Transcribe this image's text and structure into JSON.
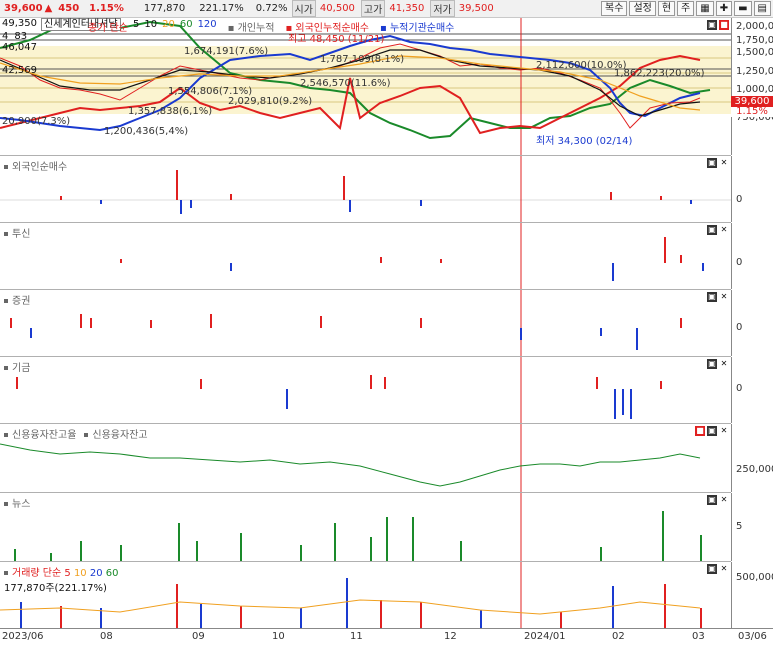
{
  "header": {
    "price": "39,600",
    "change": "450",
    "change_pct": "1.15%",
    "volume": "177,870",
    "vol_ratio": "221.17%",
    "open_pct": "0.72%",
    "open_label": "시가",
    "open_value": "40,500",
    "high_label": "고가",
    "high_value": "41,350",
    "low_label": "저가",
    "low_value": "39,500"
  },
  "toolbar": {
    "buttons": [
      "복수",
      "설정",
      "현",
      "주"
    ]
  },
  "main_chart": {
    "stock_name": "신세계인터내셔날",
    "ma_label": "종가 단순",
    "ma_periods": [
      "5",
      "10",
      "20",
      "60",
      "120"
    ],
    "legend": [
      "개인누적",
      "외국인누적순매수",
      "누적기관순매수"
    ],
    "left_values": [
      "49,350",
      "4",
      "83",
      "46,047",
      "42,569"
    ],
    "y_ticks": [
      "2,000,000",
      "1,750,000",
      "1,500,000",
      "1,250,000",
      "1,000,000",
      "750,000"
    ],
    "current_label": "39,600",
    "current_pct": "1.15%",
    "annotations": {
      "high": "최고 48,450 (11/21)",
      "low": "최저 34,300 (02/14)",
      "a1": "1,674,191(7.6%)",
      "a2": "1,787,109(8.1%)",
      "a3": "2,546,570(11.6%)",
      "a4": "1,554,806(7.1%)",
      "a5": "2,029,810(9.2%)",
      "a6": "1,357,838(6,1%)",
      "a7": "1,200,436(5,4%)",
      "a8": "2,112,600(10.0%)",
      "a9": "1,862,223(20.0%)",
      "a10": "20,900(7.3%)"
    }
  },
  "panes": {
    "foreign": {
      "title": "외국인순매수",
      "zero": "0"
    },
    "trust": {
      "title": "투신",
      "zero": "0"
    },
    "securities": {
      "title": "증권",
      "zero": "0"
    },
    "pension": {
      "title": "기금",
      "zero": "0"
    },
    "credit": {
      "title1": "신용융자잔고율",
      "title2": "신용융자잔고",
      "tick": "250,000"
    },
    "news": {
      "title": "뉴스",
      "tick": "5"
    },
    "volume": {
      "title": "거래량 단순",
      "periods": [
        "5",
        "10",
        "20",
        "60"
      ],
      "value": "177,870주(221.17%)",
      "tick": "500,000"
    }
  },
  "xaxis": {
    "labels": [
      "2023/06",
      "08",
      "09",
      "10",
      "11",
      "12",
      "2024/01",
      "02",
      "03",
      "03/06"
    ]
  },
  "colors": {
    "up": "#e02020",
    "down": "#1a3ad0",
    "green": "#1a8a2a",
    "cursor": "#e02020"
  }
}
